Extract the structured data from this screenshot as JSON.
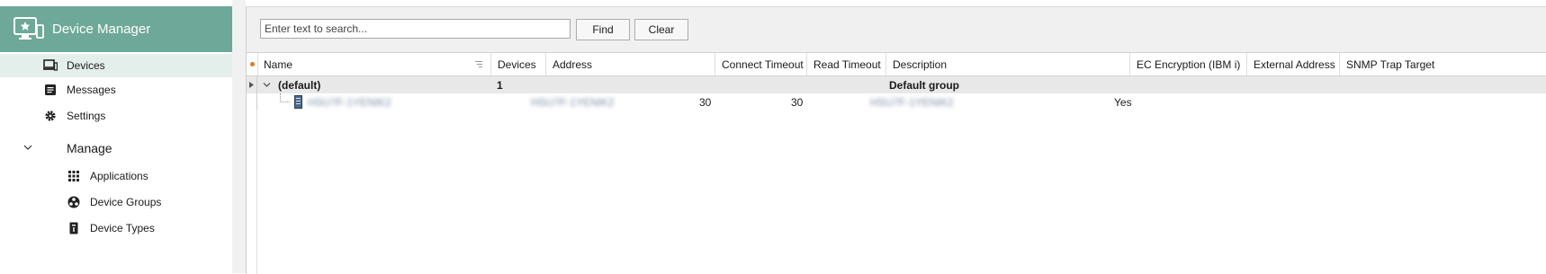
{
  "app": {
    "title": "Device Manager",
    "icon": "monitor-star-icon",
    "accent": "#6ea898"
  },
  "sidebar": {
    "items": [
      {
        "label": "Devices",
        "icon": "devices-icon",
        "active": true
      },
      {
        "label": "Messages",
        "icon": "messages-icon"
      },
      {
        "label": "Settings",
        "icon": "gear-icon"
      }
    ],
    "manage": {
      "label": "Manage",
      "items": [
        {
          "label": "Applications",
          "icon": "grid-dots-icon"
        },
        {
          "label": "Device Groups",
          "icon": "device-groups-icon"
        },
        {
          "label": "Device Types",
          "icon": "device-types-icon"
        }
      ]
    }
  },
  "toolbar": {
    "search_placeholder": "Enter text to search...",
    "find_label": "Find",
    "clear_label": "Clear"
  },
  "table": {
    "columns": [
      "Name",
      "Devices",
      "Address",
      "Connect Timeout",
      "Read Timeout",
      "Description",
      "EC Encryption (IBM i)",
      "External Address",
      "SNMP Trap Target"
    ],
    "group_row": {
      "name": "(default)",
      "devices": "1",
      "description": "Default group"
    },
    "device_row": {
      "name": "HSU7F-1YENIK2",
      "address": "HSU7F-1YENIK2",
      "connect_timeout": "30",
      "read_timeout": "30",
      "description": "HSU7F-1YENIK2",
      "ec_encryption": "Yes"
    }
  }
}
